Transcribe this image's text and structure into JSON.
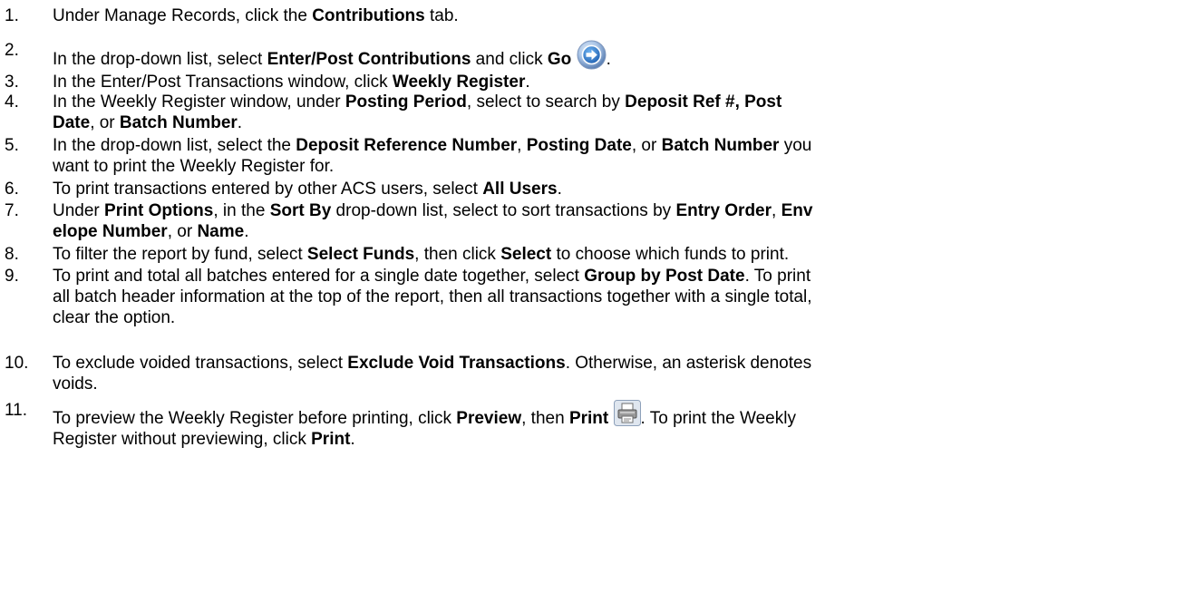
{
  "steps": [
    {
      "num": "1.",
      "segments": [
        {
          "text": "Under Manage Records, click the "
        },
        {
          "text": "Contributions",
          "bold": true
        },
        {
          "text": " tab."
        }
      ]
    },
    {
      "num": "2.",
      "segments": [
        {
          "text": "In the drop-down list, select "
        },
        {
          "text": "Enter/Post Contributions",
          "bold": true
        },
        {
          "text": " and click "
        },
        {
          "text": "Go",
          "bold": true
        },
        {
          "text": " "
        },
        {
          "icon": "go-arrow-icon"
        },
        {
          "text": "."
        }
      ]
    },
    {
      "num": "3.",
      "segments": [
        {
          "text": "In the Enter/Post Transactions window, click "
        },
        {
          "text": "Weekly Register",
          "bold": true
        },
        {
          "text": "."
        }
      ]
    },
    {
      "num": "4.",
      "segments": [
        {
          "text": "In the Weekly Register window, under "
        },
        {
          "text": "Posting Period",
          "bold": true
        },
        {
          "text": ", select to search by "
        },
        {
          "text": "Deposit Ref #, Post",
          "bold": true
        },
        {
          "break": true
        },
        {
          "text": "Date",
          "bold": true
        },
        {
          "text": ", or "
        },
        {
          "text": "Batch Number",
          "bold": true
        },
        {
          "text": "."
        }
      ]
    },
    {
      "num": "5.",
      "segments": [
        {
          "text": "In the drop-down list, select the "
        },
        {
          "text": "Deposit Reference Number",
          "bold": true
        },
        {
          "text": ", "
        },
        {
          "text": "Posting Date",
          "bold": true
        },
        {
          "text": ", or "
        },
        {
          "text": "Batch Number",
          "bold": true
        },
        {
          "text": " you"
        },
        {
          "break": true
        },
        {
          "text": "want to print the Weekly Register for."
        }
      ]
    },
    {
      "num": "6.",
      "segments": [
        {
          "text": "To print transactions entered by other ACS users, select "
        },
        {
          "text": "All Users",
          "bold": true
        },
        {
          "text": "."
        }
      ]
    },
    {
      "num": "7.",
      "segments": [
        {
          "text": "Under "
        },
        {
          "text": "Print Options",
          "bold": true
        },
        {
          "text": ", in the "
        },
        {
          "text": "Sort By",
          "bold": true
        },
        {
          "text": " drop-down list, select to sort transactions by "
        },
        {
          "text": "Entry Order",
          "bold": true
        },
        {
          "text": ", "
        },
        {
          "text": "Env",
          "bold": true
        },
        {
          "break": true
        },
        {
          "text": "elope Number",
          "bold": true
        },
        {
          "text": ", or "
        },
        {
          "text": "Name",
          "bold": true
        },
        {
          "text": "."
        }
      ]
    },
    {
      "num": "8.",
      "segments": [
        {
          "text": "To filter the report by fund, select "
        },
        {
          "text": "Select Funds",
          "bold": true
        },
        {
          "text": ", then click "
        },
        {
          "text": "Select",
          "bold": true
        },
        {
          "text": " to choose which funds to print."
        }
      ]
    },
    {
      "num": "9.",
      "segments": [
        {
          "text": "To print and total all batches entered for a single date together, select "
        },
        {
          "text": "Group by Post Date",
          "bold": true
        },
        {
          "text": ". To print"
        },
        {
          "break": true
        },
        {
          "text": "all batch header information at the top of the report, then all transactions together with a single total,"
        },
        {
          "break": true
        },
        {
          "text": "clear the option."
        }
      ]
    },
    {
      "num": "10.",
      "segments": [
        {
          "text": "To exclude voided transactions, select "
        },
        {
          "text": "Exclude Void Transactions",
          "bold": true
        },
        {
          "text": ". Otherwise, an asterisk denotes"
        },
        {
          "break": true
        },
        {
          "text": "voids."
        }
      ]
    },
    {
      "num": "11.",
      "segments": [
        {
          "text": "To preview the Weekly Register before printing, click "
        },
        {
          "text": "Preview",
          "bold": true
        },
        {
          "text": ", then "
        },
        {
          "text": "Print",
          "bold": true
        },
        {
          "text": " "
        },
        {
          "icon": "printer-icon"
        },
        {
          "text": ". To print the Weekly"
        },
        {
          "break": true
        },
        {
          "text": "Register without previewing, click "
        },
        {
          "text": "Print",
          "bold": true
        },
        {
          "text": "."
        }
      ]
    }
  ]
}
